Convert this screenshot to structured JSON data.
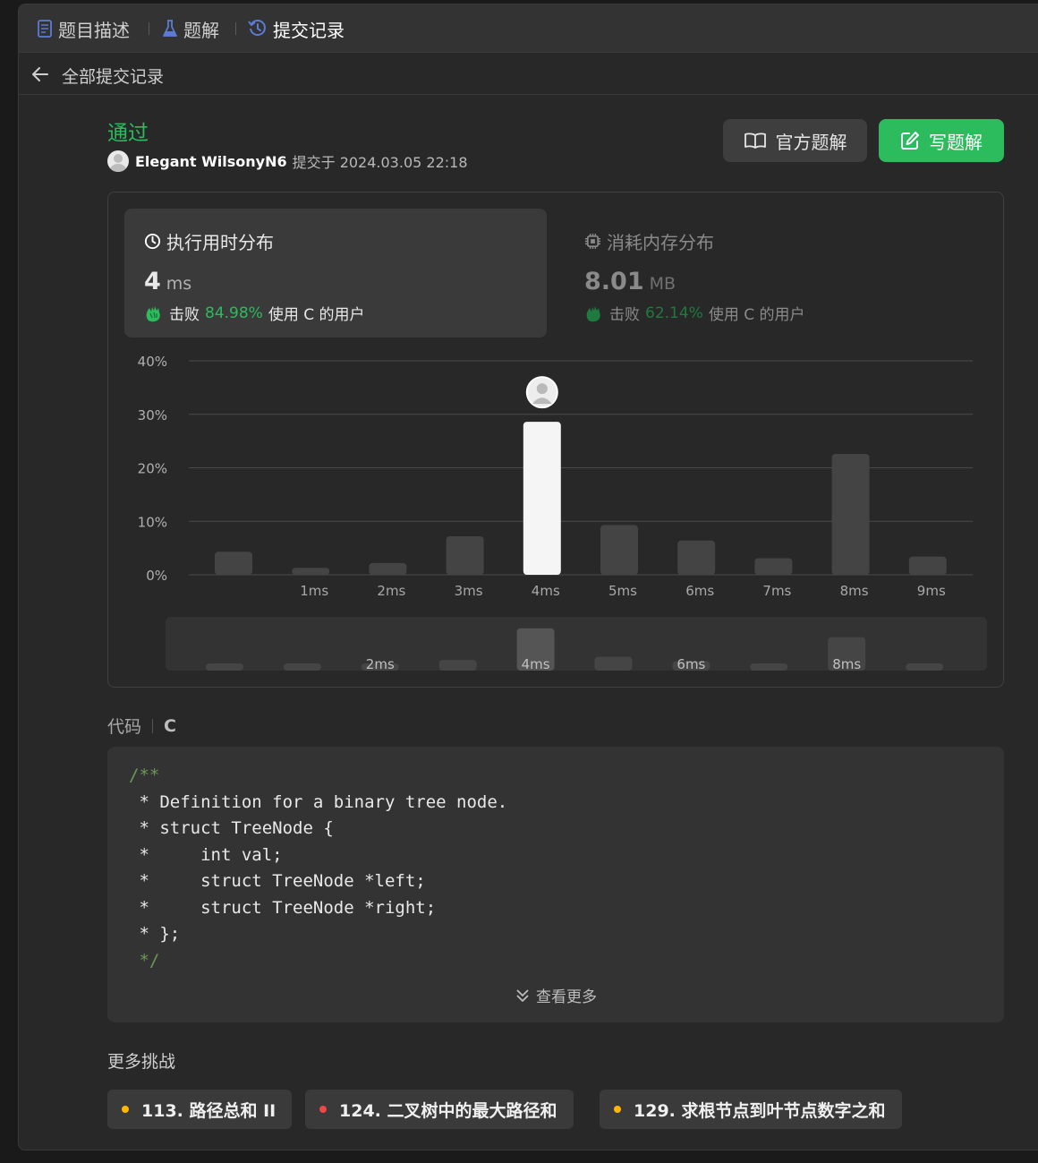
{
  "tabs": [
    {
      "label": "题目描述",
      "icon": "document-icon"
    },
    {
      "label": "题解",
      "icon": "flask-icon"
    },
    {
      "label": "提交记录",
      "icon": "history-icon",
      "active": true
    }
  ],
  "subheader": {
    "back_icon": "arrow-left-icon",
    "title": "全部提交记录"
  },
  "submission": {
    "status": "通过",
    "user": "Elegant WilsonyN6",
    "submitted_text": "提交于 2024.03.05 22:18"
  },
  "buttons": {
    "official_solution": "官方题解",
    "write_solution": "写题解"
  },
  "runtime": {
    "title": "执行用时分布",
    "value": "4",
    "unit": "ms",
    "beat_label": "击败",
    "beat_pct": "84.98%",
    "beat_suffix": "使用 C 的用户"
  },
  "memory": {
    "title": "消耗内存分布",
    "value": "8.01",
    "unit": "MB",
    "beat_label": "击败",
    "beat_pct": "62.14%",
    "beat_suffix": "使用 C 的用户"
  },
  "colors": {
    "accent_green": "#2cbb5d",
    "bar": "#444444",
    "bar_selected": "#f5f5f5",
    "chip_dot_yellow": "#ffb800",
    "chip_dot_red": "#ef4743"
  },
  "chart_data": {
    "type": "bar",
    "categories": [
      "",
      "1ms",
      "2ms",
      "3ms",
      "4ms",
      "5ms",
      "6ms",
      "7ms",
      "8ms",
      "9ms"
    ],
    "values": [
      4.3,
      1.3,
      2.2,
      7.2,
      28.6,
      9.3,
      6.4,
      3.1,
      22.6,
      3.4
    ],
    "selected_index": 4,
    "ylim": [
      0,
      40
    ],
    "yticks": [
      "0%",
      "10%",
      "20%",
      "30%",
      "40%"
    ],
    "ytick_values": [
      0,
      10,
      20,
      30,
      40
    ],
    "grid": true,
    "overview_labels": [
      "",
      "",
      "2ms",
      "",
      "4ms",
      "",
      "6ms",
      "",
      "8ms",
      ""
    ]
  },
  "code": {
    "label": "代码",
    "language": "C",
    "lines": [
      "/**",
      " * Definition for a binary tree node.",
      " * struct TreeNode {",
      " *     int val;",
      " *     struct TreeNode *left;",
      " *     struct TreeNode *right;",
      " * };",
      " */"
    ],
    "more": "查看更多"
  },
  "challenges": {
    "title": "更多挑战",
    "items": [
      {
        "label": "113. 路径总和 II",
        "dot": "#ffb800"
      },
      {
        "label": "124. 二叉树中的最大路径和",
        "dot": "#ef4743"
      },
      {
        "label": "129. 求根节点到叶节点数字之和",
        "dot": "#ffb800"
      }
    ]
  }
}
